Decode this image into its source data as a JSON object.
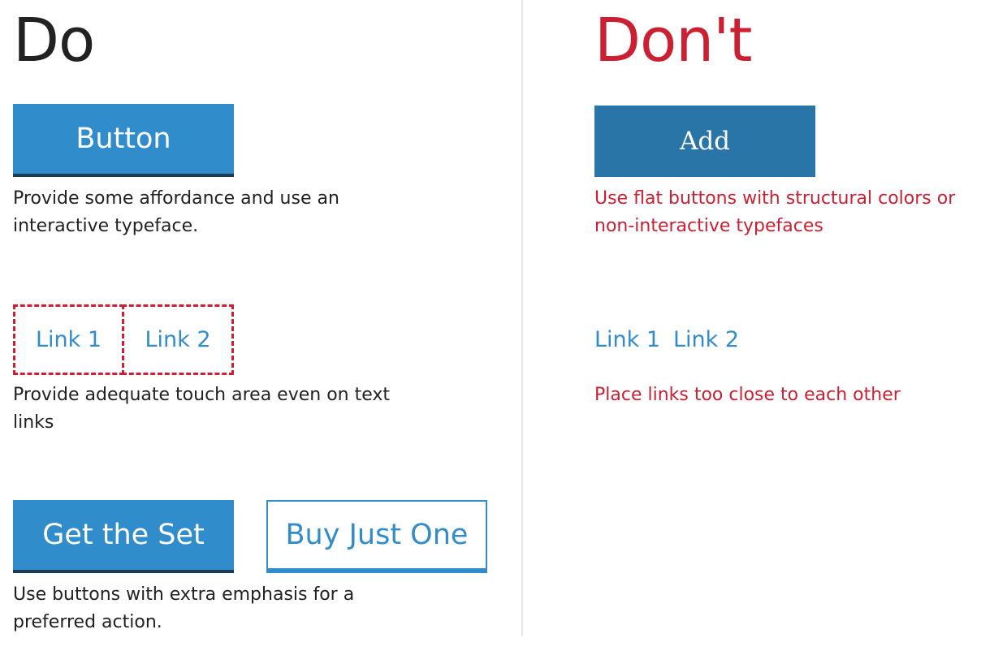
{
  "do": {
    "heading": "Do",
    "button_label": "Button",
    "button_caption": "Provide some affordance and use an interactive typeface.",
    "links": [
      "Link 1",
      "Link 2"
    ],
    "links_caption": "Provide adequate touch area even on text links",
    "primary_cta": "Get the Set",
    "secondary_cta": "Buy Just One",
    "cta_caption": "Use buttons with extra emphasis for a preferred action."
  },
  "dont": {
    "heading": "Don't",
    "button_label": "Add",
    "button_caption": "Use flat buttons with structural colors or non-interactive typefaces",
    "links": [
      "Link 1",
      "Link 2"
    ],
    "links_caption": "Place links too close to each other"
  },
  "colors": {
    "accent_blue": "#318ccb",
    "dark_bar": "#1a3c54",
    "flat_blue": "#2a75a8",
    "warning_red": "#cc1f32",
    "divider": "#e6e6e6"
  }
}
